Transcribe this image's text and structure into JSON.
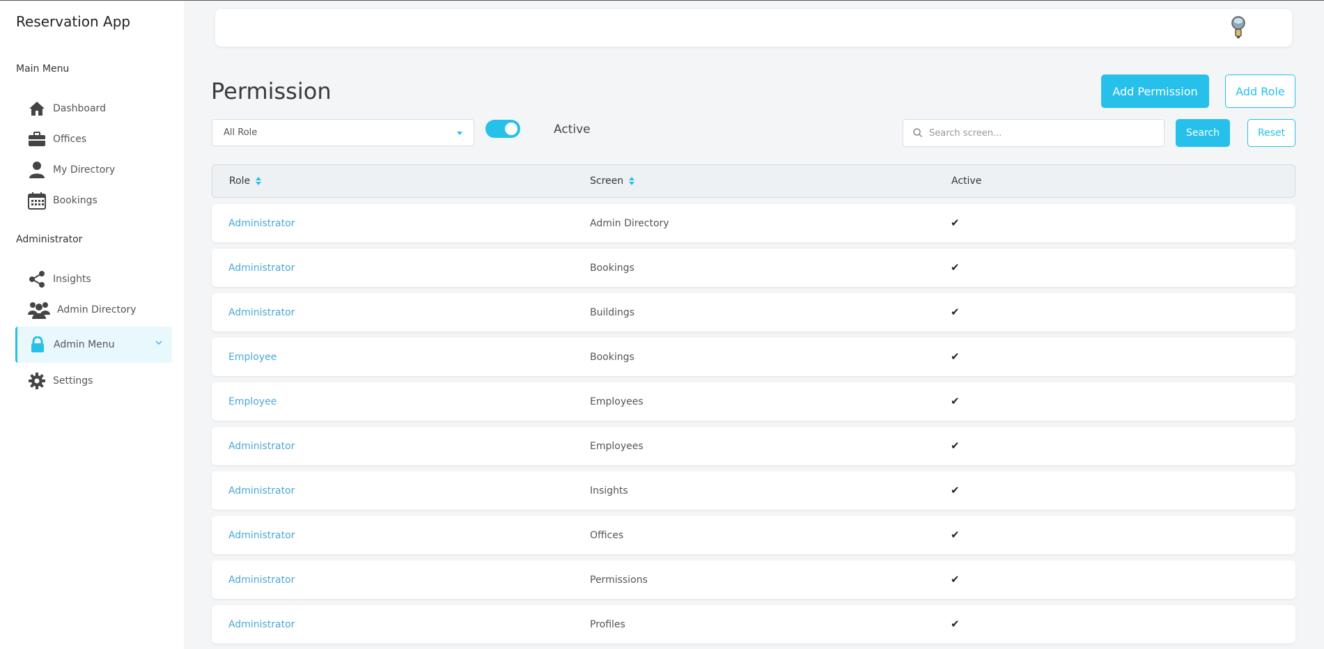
{
  "app": {
    "title": "Reservation App"
  },
  "sidebar": {
    "main_menu_label": "Main Menu",
    "main_items": [
      {
        "label": "Dashboard",
        "icon": "home-icon"
      },
      {
        "label": "Offices",
        "icon": "briefcase-icon"
      },
      {
        "label": "My Directory",
        "icon": "user-icon"
      },
      {
        "label": "Bookings",
        "icon": "calendar-icon"
      }
    ],
    "admin_label": "Administrator",
    "admin_items": [
      {
        "label": "Insights",
        "icon": "share-icon"
      },
      {
        "label": "Admin Directory",
        "icon": "users-icon"
      },
      {
        "label": "Admin Menu",
        "icon": "lock-icon",
        "active": true
      },
      {
        "label": "Settings",
        "icon": "gear-icon"
      }
    ]
  },
  "page": {
    "title": "Permission",
    "add_permission_label": "Add Permission",
    "add_role_label": "Add Role"
  },
  "filters": {
    "role_select_value": "All Role",
    "active_toggle_on": true,
    "active_label": "Active",
    "search_placeholder": "Search screen...",
    "search_label": "Search",
    "reset_label": "Reset"
  },
  "table": {
    "columns": [
      "Role",
      "Screen",
      "Active"
    ],
    "rows": [
      {
        "role": "Administrator",
        "screen": "Admin Directory",
        "active": "✔"
      },
      {
        "role": "Administrator",
        "screen": "Bookings",
        "active": "✔"
      },
      {
        "role": "Administrator",
        "screen": "Buildings",
        "active": "✔"
      },
      {
        "role": "Employee",
        "screen": "Bookings",
        "active": "✔"
      },
      {
        "role": "Employee",
        "screen": "Employees",
        "active": "✔"
      },
      {
        "role": "Administrator",
        "screen": "Employees",
        "active": "✔"
      },
      {
        "role": "Administrator",
        "screen": "Insights",
        "active": "✔"
      },
      {
        "role": "Administrator",
        "screen": "Offices",
        "active": "✔"
      },
      {
        "role": "Administrator",
        "screen": "Permissions",
        "active": "✔"
      },
      {
        "role": "Administrator",
        "screen": "Profiles",
        "active": "✔"
      }
    ]
  },
  "colors": {
    "accent": "#26c0ea",
    "link": "#4aa8d8",
    "background": "#f3f5f7"
  }
}
